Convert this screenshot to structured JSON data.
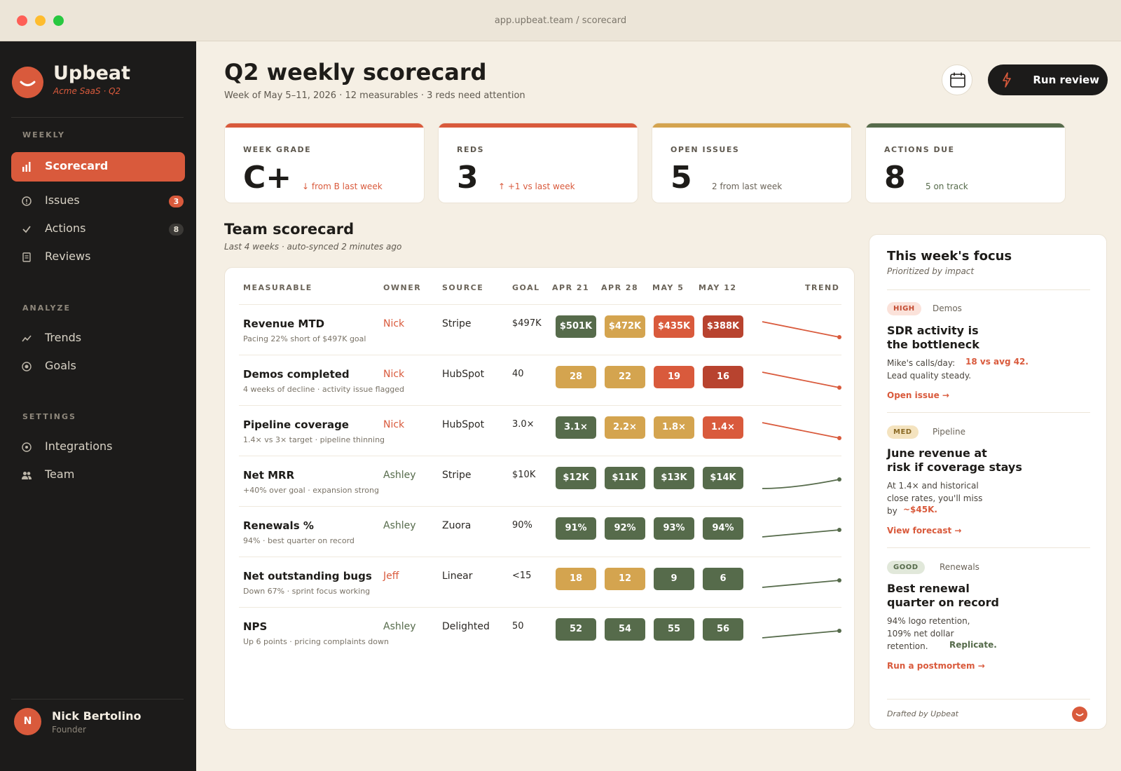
{
  "window": {
    "url": "app.upbeat.team / scorecard"
  },
  "brand": {
    "name": "Upbeat",
    "subtitle": "Acme SaaS · Q2"
  },
  "sidebar": {
    "sections": [
      {
        "label": "WEEKLY"
      },
      {
        "label": "ANALYZE"
      },
      {
        "label": "SETTINGS"
      }
    ],
    "items": [
      {
        "label": "Scorecard",
        "icon": "bar-chart-icon",
        "active": true
      },
      {
        "label": "Issues",
        "icon": "alert-circle-icon",
        "badge": "3"
      },
      {
        "label": "Actions",
        "icon": "check-icon",
        "badge": "8"
      },
      {
        "label": "Reviews",
        "icon": "document-icon"
      },
      {
        "label": "Trends",
        "icon": "trend-line-icon"
      },
      {
        "label": "Goals",
        "icon": "target-icon"
      },
      {
        "label": "Integrations",
        "icon": "plug-icon"
      },
      {
        "label": "Team",
        "icon": "people-icon"
      }
    ],
    "user": {
      "initial": "N",
      "name": "Nick Bertolino",
      "role": "Founder"
    }
  },
  "header": {
    "title": "Q2 weekly scorecard",
    "subtitle": "Week of May 5–11, 2026 · 12 measurables · 3 reds need attention",
    "run_label": "Run review"
  },
  "kpis": [
    {
      "label": "WEEK GRADE",
      "value": "C+",
      "note": "↓ from B last week",
      "tone": "red"
    },
    {
      "label": "REDS",
      "value": "3",
      "note": "↑ +1 vs last week",
      "tone": "red"
    },
    {
      "label": "OPEN ISSUES",
      "value": "5",
      "note": "2 from last week",
      "tone": "amber"
    },
    {
      "label": "ACTIONS DUE",
      "value": "8",
      "note": "5 on track",
      "tone": "green"
    }
  ],
  "scorecard": {
    "title": "Team scorecard",
    "subtitle": "Last 4 weeks · auto-synced 2 minutes ago",
    "columns": [
      "MEASURABLE",
      "OWNER",
      "SOURCE",
      "GOAL",
      "APR 21",
      "APR 28",
      "MAY 5",
      "MAY 12",
      "TREND"
    ],
    "rows": [
      {
        "name": "Revenue MTD",
        "note": "Pacing 22% short of $497K goal",
        "owner": "Nick",
        "owner_tone": "red",
        "source": "Stripe",
        "goal": "$497K",
        "weeks": [
          {
            "v": "$501K",
            "s": "green"
          },
          {
            "v": "$472K",
            "s": "amber"
          },
          {
            "v": "$435K",
            "s": "red"
          },
          {
            "v": "$388K",
            "s": "darkred"
          }
        ],
        "trend": "down"
      },
      {
        "name": "Demos completed",
        "note": "4 weeks of decline · activity issue flagged",
        "owner": "Nick",
        "owner_tone": "red",
        "source": "HubSpot",
        "goal": "40",
        "weeks": [
          {
            "v": "28",
            "s": "amber"
          },
          {
            "v": "22",
            "s": "amber"
          },
          {
            "v": "19",
            "s": "red"
          },
          {
            "v": "16",
            "s": "darkred"
          }
        ],
        "trend": "down"
      },
      {
        "name": "Pipeline coverage",
        "note": "1.4× vs 3× target · pipeline thinning",
        "owner": "Nick",
        "owner_tone": "red",
        "source": "HubSpot",
        "goal": "3.0×",
        "weeks": [
          {
            "v": "3.1×",
            "s": "green"
          },
          {
            "v": "2.2×",
            "s": "amber"
          },
          {
            "v": "1.8×",
            "s": "amber"
          },
          {
            "v": "1.4×",
            "s": "red"
          }
        ],
        "trend": "down"
      },
      {
        "name": "Net MRR",
        "note": "+40% over goal · expansion strong",
        "owner": "Ashley",
        "owner_tone": "green",
        "source": "Stripe",
        "goal": "$10K",
        "weeks": [
          {
            "v": "$12K",
            "s": "green"
          },
          {
            "v": "$11K",
            "s": "green"
          },
          {
            "v": "$13K",
            "s": "green"
          },
          {
            "v": "$14K",
            "s": "green"
          }
        ],
        "trend": "up-curve"
      },
      {
        "name": "Renewals %",
        "note": "94% · best quarter on record",
        "owner": "Ashley",
        "owner_tone": "green",
        "source": "Zuora",
        "goal": "90%",
        "weeks": [
          {
            "v": "91%",
            "s": "green"
          },
          {
            "v": "92%",
            "s": "green"
          },
          {
            "v": "93%",
            "s": "green"
          },
          {
            "v": "94%",
            "s": "green"
          }
        ],
        "trend": "up"
      },
      {
        "name": "Net outstanding bugs",
        "note": "Down 67% · sprint focus working",
        "owner": "Jeff",
        "owner_tone": "red",
        "source": "Linear",
        "goal": "<15",
        "weeks": [
          {
            "v": "18",
            "s": "amber"
          },
          {
            "v": "12",
            "s": "amber"
          },
          {
            "v": "9",
            "s": "green"
          },
          {
            "v": "6",
            "s": "green"
          }
        ],
        "trend": "up"
      },
      {
        "name": "NPS",
        "note": "Up 6 points · pricing complaints down",
        "owner": "Ashley",
        "owner_tone": "green",
        "source": "Delighted",
        "goal": "50",
        "weeks": [
          {
            "v": "52",
            "s": "green"
          },
          {
            "v": "54",
            "s": "green"
          },
          {
            "v": "55",
            "s": "green"
          },
          {
            "v": "56",
            "s": "green"
          }
        ],
        "trend": "up"
      }
    ]
  },
  "focus": {
    "title": "This week's focus",
    "subtitle": "Prioritized by impact",
    "items": [
      {
        "tag": "HIGH",
        "category": "Demos",
        "head_1": "SDR activity is",
        "head_2": "the bottleneck",
        "body_1": "Mike's calls/day:",
        "highlight": "18 vs avg 42.",
        "body_2": "Lead quality steady.",
        "link": "Open issue →"
      },
      {
        "tag": "MED",
        "category": "Pipeline",
        "head_1": "June revenue at",
        "head_2": "risk if coverage stays",
        "body_1": "At 1.4× and historical",
        "body_2": "close rates, you'll miss",
        "body_3": "by",
        "highlight": "~$45K.",
        "link": "View forecast →"
      },
      {
        "tag": "GOOD",
        "category": "Renewals",
        "head_1": "Best renewal",
        "head_2": "quarter on record",
        "body_1": "94% logo retention,",
        "body_2": "109% net dollar",
        "body_3": "retention.",
        "highlight": "Replicate.",
        "link": "Run a postmortem →"
      }
    ],
    "footer": "Drafted by Upbeat"
  },
  "colors": {
    "accent": "#d95a3c",
    "green": "#566b4b",
    "amber": "#d4a44f",
    "red": "#d95a3c",
    "darkred": "#b8432f",
    "sidebar_bg": "#1c1b1a",
    "page_bg": "#f5efe4"
  }
}
